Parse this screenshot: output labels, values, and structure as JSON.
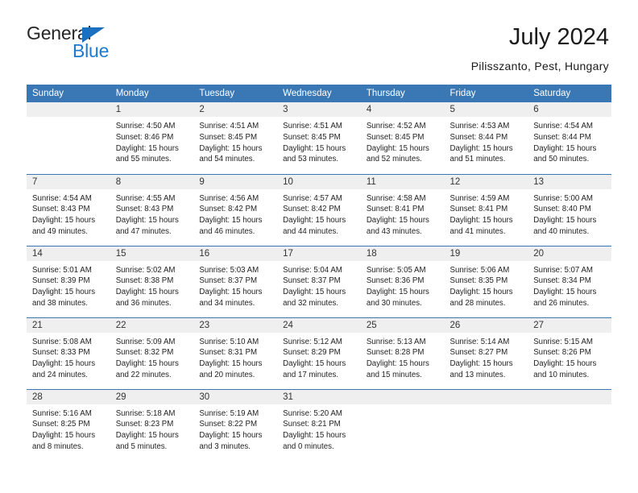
{
  "brand": {
    "name_part1": "General",
    "name_part2": "Blue",
    "triangle_icon": "triangle-logo-icon",
    "accent_color": "#1b7ad0"
  },
  "header": {
    "title": "July 2024",
    "subtitle": "Pilisszanto, Pest, Hungary"
  },
  "colors": {
    "header_blue": "#3a78b5",
    "daynum_gray": "#efefef",
    "text": "#1f1f1f"
  },
  "weekdays": [
    "Sunday",
    "Monday",
    "Tuesday",
    "Wednesday",
    "Thursday",
    "Friday",
    "Saturday"
  ],
  "weeks": [
    [
      {
        "day": "",
        "empty": true,
        "sunrise": "",
        "sunset": "",
        "daylight1": "",
        "daylight2": ""
      },
      {
        "day": "1",
        "empty": false,
        "sunrise": "Sunrise: 4:50 AM",
        "sunset": "Sunset: 8:46 PM",
        "daylight1": "Daylight: 15 hours",
        "daylight2": "and 55 minutes."
      },
      {
        "day": "2",
        "empty": false,
        "sunrise": "Sunrise: 4:51 AM",
        "sunset": "Sunset: 8:45 PM",
        "daylight1": "Daylight: 15 hours",
        "daylight2": "and 54 minutes."
      },
      {
        "day": "3",
        "empty": false,
        "sunrise": "Sunrise: 4:51 AM",
        "sunset": "Sunset: 8:45 PM",
        "daylight1": "Daylight: 15 hours",
        "daylight2": "and 53 minutes."
      },
      {
        "day": "4",
        "empty": false,
        "sunrise": "Sunrise: 4:52 AM",
        "sunset": "Sunset: 8:45 PM",
        "daylight1": "Daylight: 15 hours",
        "daylight2": "and 52 minutes."
      },
      {
        "day": "5",
        "empty": false,
        "sunrise": "Sunrise: 4:53 AM",
        "sunset": "Sunset: 8:44 PM",
        "daylight1": "Daylight: 15 hours",
        "daylight2": "and 51 minutes."
      },
      {
        "day": "6",
        "empty": false,
        "sunrise": "Sunrise: 4:54 AM",
        "sunset": "Sunset: 8:44 PM",
        "daylight1": "Daylight: 15 hours",
        "daylight2": "and 50 minutes."
      }
    ],
    [
      {
        "day": "7",
        "empty": false,
        "sunrise": "Sunrise: 4:54 AM",
        "sunset": "Sunset: 8:43 PM",
        "daylight1": "Daylight: 15 hours",
        "daylight2": "and 49 minutes."
      },
      {
        "day": "8",
        "empty": false,
        "sunrise": "Sunrise: 4:55 AM",
        "sunset": "Sunset: 8:43 PM",
        "daylight1": "Daylight: 15 hours",
        "daylight2": "and 47 minutes."
      },
      {
        "day": "9",
        "empty": false,
        "sunrise": "Sunrise: 4:56 AM",
        "sunset": "Sunset: 8:42 PM",
        "daylight1": "Daylight: 15 hours",
        "daylight2": "and 46 minutes."
      },
      {
        "day": "10",
        "empty": false,
        "sunrise": "Sunrise: 4:57 AM",
        "sunset": "Sunset: 8:42 PM",
        "daylight1": "Daylight: 15 hours",
        "daylight2": "and 44 minutes."
      },
      {
        "day": "11",
        "empty": false,
        "sunrise": "Sunrise: 4:58 AM",
        "sunset": "Sunset: 8:41 PM",
        "daylight1": "Daylight: 15 hours",
        "daylight2": "and 43 minutes."
      },
      {
        "day": "12",
        "empty": false,
        "sunrise": "Sunrise: 4:59 AM",
        "sunset": "Sunset: 8:41 PM",
        "daylight1": "Daylight: 15 hours",
        "daylight2": "and 41 minutes."
      },
      {
        "day": "13",
        "empty": false,
        "sunrise": "Sunrise: 5:00 AM",
        "sunset": "Sunset: 8:40 PM",
        "daylight1": "Daylight: 15 hours",
        "daylight2": "and 40 minutes."
      }
    ],
    [
      {
        "day": "14",
        "empty": false,
        "sunrise": "Sunrise: 5:01 AM",
        "sunset": "Sunset: 8:39 PM",
        "daylight1": "Daylight: 15 hours",
        "daylight2": "and 38 minutes."
      },
      {
        "day": "15",
        "empty": false,
        "sunrise": "Sunrise: 5:02 AM",
        "sunset": "Sunset: 8:38 PM",
        "daylight1": "Daylight: 15 hours",
        "daylight2": "and 36 minutes."
      },
      {
        "day": "16",
        "empty": false,
        "sunrise": "Sunrise: 5:03 AM",
        "sunset": "Sunset: 8:37 PM",
        "daylight1": "Daylight: 15 hours",
        "daylight2": "and 34 minutes."
      },
      {
        "day": "17",
        "empty": false,
        "sunrise": "Sunrise: 5:04 AM",
        "sunset": "Sunset: 8:37 PM",
        "daylight1": "Daylight: 15 hours",
        "daylight2": "and 32 minutes."
      },
      {
        "day": "18",
        "empty": false,
        "sunrise": "Sunrise: 5:05 AM",
        "sunset": "Sunset: 8:36 PM",
        "daylight1": "Daylight: 15 hours",
        "daylight2": "and 30 minutes."
      },
      {
        "day": "19",
        "empty": false,
        "sunrise": "Sunrise: 5:06 AM",
        "sunset": "Sunset: 8:35 PM",
        "daylight1": "Daylight: 15 hours",
        "daylight2": "and 28 minutes."
      },
      {
        "day": "20",
        "empty": false,
        "sunrise": "Sunrise: 5:07 AM",
        "sunset": "Sunset: 8:34 PM",
        "daylight1": "Daylight: 15 hours",
        "daylight2": "and 26 minutes."
      }
    ],
    [
      {
        "day": "21",
        "empty": false,
        "sunrise": "Sunrise: 5:08 AM",
        "sunset": "Sunset: 8:33 PM",
        "daylight1": "Daylight: 15 hours",
        "daylight2": "and 24 minutes."
      },
      {
        "day": "22",
        "empty": false,
        "sunrise": "Sunrise: 5:09 AM",
        "sunset": "Sunset: 8:32 PM",
        "daylight1": "Daylight: 15 hours",
        "daylight2": "and 22 minutes."
      },
      {
        "day": "23",
        "empty": false,
        "sunrise": "Sunrise: 5:10 AM",
        "sunset": "Sunset: 8:31 PM",
        "daylight1": "Daylight: 15 hours",
        "daylight2": "and 20 minutes."
      },
      {
        "day": "24",
        "empty": false,
        "sunrise": "Sunrise: 5:12 AM",
        "sunset": "Sunset: 8:29 PM",
        "daylight1": "Daylight: 15 hours",
        "daylight2": "and 17 minutes."
      },
      {
        "day": "25",
        "empty": false,
        "sunrise": "Sunrise: 5:13 AM",
        "sunset": "Sunset: 8:28 PM",
        "daylight1": "Daylight: 15 hours",
        "daylight2": "and 15 minutes."
      },
      {
        "day": "26",
        "empty": false,
        "sunrise": "Sunrise: 5:14 AM",
        "sunset": "Sunset: 8:27 PM",
        "daylight1": "Daylight: 15 hours",
        "daylight2": "and 13 minutes."
      },
      {
        "day": "27",
        "empty": false,
        "sunrise": "Sunrise: 5:15 AM",
        "sunset": "Sunset: 8:26 PM",
        "daylight1": "Daylight: 15 hours",
        "daylight2": "and 10 minutes."
      }
    ],
    [
      {
        "day": "28",
        "empty": false,
        "sunrise": "Sunrise: 5:16 AM",
        "sunset": "Sunset: 8:25 PM",
        "daylight1": "Daylight: 15 hours",
        "daylight2": "and 8 minutes."
      },
      {
        "day": "29",
        "empty": false,
        "sunrise": "Sunrise: 5:18 AM",
        "sunset": "Sunset: 8:23 PM",
        "daylight1": "Daylight: 15 hours",
        "daylight2": "and 5 minutes."
      },
      {
        "day": "30",
        "empty": false,
        "sunrise": "Sunrise: 5:19 AM",
        "sunset": "Sunset: 8:22 PM",
        "daylight1": "Daylight: 15 hours",
        "daylight2": "and 3 minutes."
      },
      {
        "day": "31",
        "empty": false,
        "sunrise": "Sunrise: 5:20 AM",
        "sunset": "Sunset: 8:21 PM",
        "daylight1": "Daylight: 15 hours",
        "daylight2": "and 0 minutes."
      },
      {
        "day": "",
        "empty": true,
        "sunrise": "",
        "sunset": "",
        "daylight1": "",
        "daylight2": ""
      },
      {
        "day": "",
        "empty": true,
        "sunrise": "",
        "sunset": "",
        "daylight1": "",
        "daylight2": ""
      },
      {
        "day": "",
        "empty": true,
        "sunrise": "",
        "sunset": "",
        "daylight1": "",
        "daylight2": ""
      }
    ]
  ]
}
